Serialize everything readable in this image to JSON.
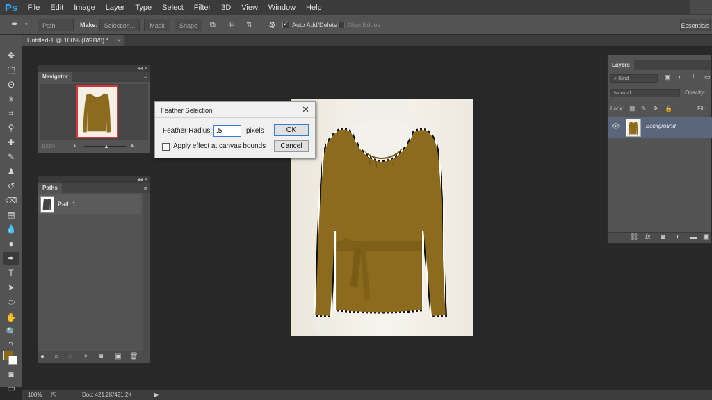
{
  "app": {
    "logo": "Ps",
    "menu": [
      "File",
      "Edit",
      "Image",
      "Layer",
      "Type",
      "Select",
      "Filter",
      "3D",
      "View",
      "Window",
      "Help"
    ],
    "window_minimize": "—"
  },
  "options_bar": {
    "mode": "Path",
    "make_label": "Make:",
    "selection_btn": "Selection...",
    "mask_btn": "Mask",
    "shape_btn": "Shape",
    "auto_add_delete": "Auto Add/Delete",
    "auto_add_delete_checked": true,
    "align_edges": "Align Edges",
    "align_edges_checked": false,
    "workspace": "Essentials"
  },
  "document": {
    "tab_title": "Untitled-1 @ 100% (RGB/8) *",
    "tab_close": "×"
  },
  "navigator": {
    "title": "Navigator",
    "zoom": "100%",
    "menu": "≡",
    "collapse": "◂◂ ×"
  },
  "paths": {
    "title": "Paths",
    "items": [
      {
        "label": "Path 1"
      }
    ],
    "menu": "≡",
    "collapse": "◂◂ ×"
  },
  "dialog": {
    "title": "Feather Selection",
    "close": "✕",
    "radius_label": "Feather Radius:",
    "radius_value": ".5",
    "radius_unit": "pixels",
    "ok_label": "OK",
    "cancel_label": "Cancel",
    "apply_label": "Apply effect at canvas bounds",
    "apply_checked": false
  },
  "layers": {
    "title": "Layers",
    "kind_filter": "Kind",
    "blend_mode": "Normal",
    "opacity_label": "Opacity:",
    "lock_label": "Lock:",
    "fill_label": "Fill:",
    "items": [
      {
        "name": "Background",
        "visible": true
      }
    ],
    "menu": "≡"
  },
  "status": {
    "zoom": "100%",
    "doc_info": "Doc: 421.2K/421.2K"
  },
  "colors": {
    "foreground": "#8a6a1a",
    "background": "#ffffff",
    "sweater": "#8c6a1e"
  }
}
